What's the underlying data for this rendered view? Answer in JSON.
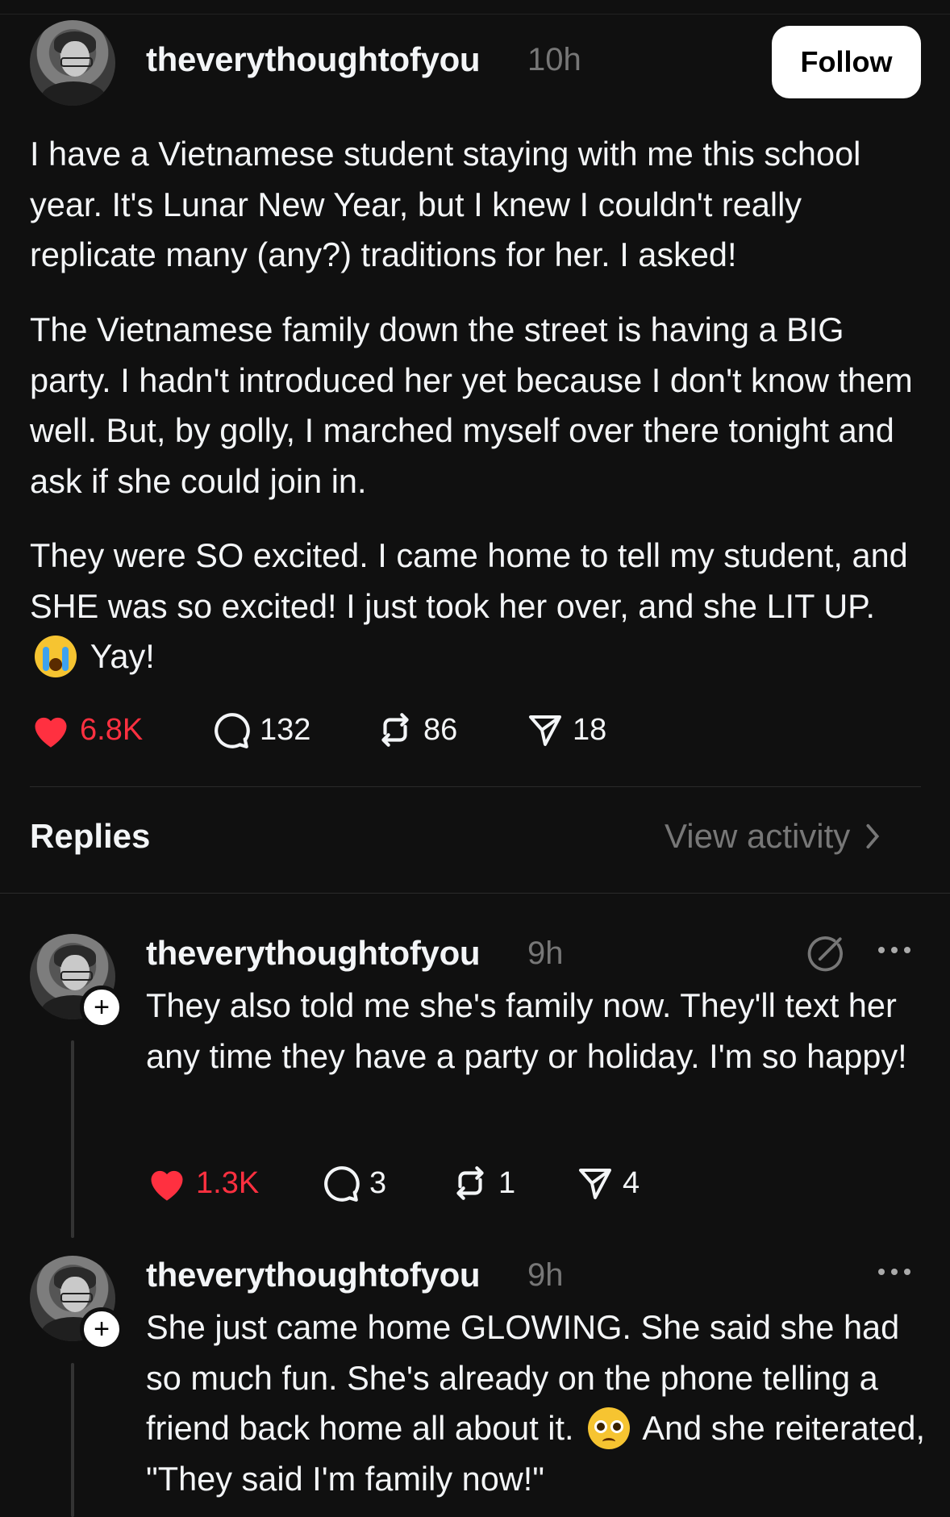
{
  "post": {
    "username": "theverythoughtofyou",
    "time": "10h",
    "follow_label": "Follow",
    "paragraphs": [
      "I have a Vietnamese student staying with me this school year. It's Lunar New Year, but I knew I couldn't really replicate many (any?) traditions for her. I asked!",
      "The Vietnamese family down the street is having a BIG party. I hadn't introduced her yet because I don't know them well. But, by golly, I marched myself over there tonight and ask if she could join in.",
      "They were SO excited. I came home to tell my student, and SHE was so excited! I just took her over, and she LIT UP."
    ],
    "after_emoji": "Yay!",
    "emoji": "loudly-crying-face",
    "likes": "6.8K",
    "comments": "132",
    "reposts": "86",
    "shares": "18"
  },
  "replies_header": {
    "title": "Replies",
    "view_activity": "View activity"
  },
  "replies": [
    {
      "username": "theverythoughtofyou",
      "time": "9h",
      "text": "They also told me she's family now. They'll text her any time they have a party or holiday. I'm so happy!",
      "likes": "1.3K",
      "comments": "3",
      "reposts": "1",
      "shares": "4"
    },
    {
      "username": "theverythoughtofyou",
      "time": "9h",
      "text_before_emoji": "She just came home GLOWING. She said she had so much fun. She's already on the phone telling a friend back home all about it.",
      "emoji": "pleading-face",
      "text_after_emoji": "And she reiterated, \"They said I'm family now!\""
    }
  ],
  "colors": {
    "background": "#101010",
    "text": "#f3f5f7",
    "muted": "#777777",
    "like": "#ff3040",
    "follow_bg": "#ffffff"
  }
}
